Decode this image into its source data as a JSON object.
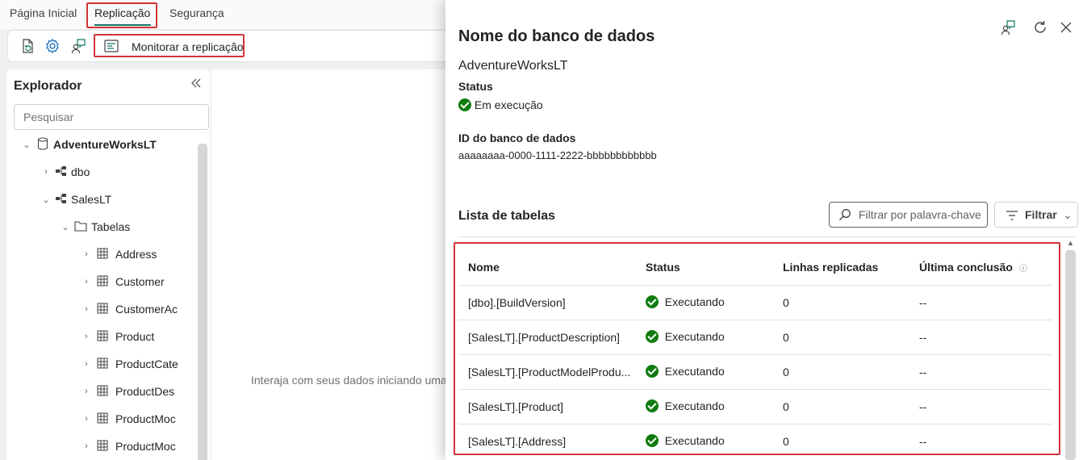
{
  "ribbon": {
    "tabs": [
      "Página Inicial",
      "Replicação",
      "Segurança"
    ],
    "active_tab": "Replicação"
  },
  "toolbar": {
    "monitor_label": "Monitorar a replicação",
    "icons": [
      "document-refresh-icon",
      "gear-icon",
      "person-feedback-icon",
      "monitor-icon"
    ]
  },
  "explorer": {
    "title": "Explorador",
    "search_placeholder": "Pesquisar",
    "tree": [
      {
        "label": "AdventureWorksLT",
        "icon": "database-icon",
        "expanded": true
      },
      {
        "label": "dbo",
        "icon": "schema-icon",
        "expanded": false
      },
      {
        "label": "SalesLT",
        "icon": "schema-icon",
        "expanded": true
      },
      {
        "label": "Tabelas",
        "icon": "folder-icon",
        "expanded": true
      },
      {
        "label": "Address",
        "icon": "table-icon"
      },
      {
        "label": "Customer",
        "icon": "table-icon"
      },
      {
        "label": "CustomerAc",
        "icon": "table-icon"
      },
      {
        "label": "Product",
        "icon": "table-icon"
      },
      {
        "label": "ProductCate",
        "icon": "table-icon"
      },
      {
        "label": "ProductDes",
        "icon": "table-icon"
      },
      {
        "label": "ProductMoc",
        "icon": "table-icon"
      },
      {
        "label": "ProductMoc",
        "icon": "table-icon"
      }
    ]
  },
  "main": {
    "empty_text": "Interaja com seus dados iniciando uma"
  },
  "panel": {
    "title": "Nome do banco de dados",
    "db_name": "AdventureWorksLT",
    "status_label": "Status",
    "status_value": "Em execução",
    "id_label": "ID do banco de dados",
    "id_value": "aaaaaaaa-0000-1111-2222-bbbbbbbbbbbb",
    "list_title": "Lista de tabelas",
    "filter_keyword_placeholder": "Filtrar por palavra-chave",
    "filter_label": "Filtrar",
    "columns": [
      "Nome",
      "Status",
      "Linhas replicadas",
      "Última conclusão"
    ],
    "rows": [
      {
        "name": "[dbo].[BuildVersion]",
        "status": "Executando",
        "rows": "0",
        "last": "--"
      },
      {
        "name": "[SalesLT].[ProductDescription]",
        "status": "Executando",
        "rows": "0",
        "last": "--"
      },
      {
        "name": "[SalesLT].[ProductModelProdu...",
        "status": "Executando",
        "rows": "0",
        "last": "--"
      },
      {
        "name": "[SalesLT].[Product]",
        "status": "Executando",
        "rows": "0",
        "last": "--"
      },
      {
        "name": "[SalesLT].[Address]",
        "status": "Executando",
        "rows": "0",
        "last": "--"
      }
    ],
    "status_color": "#107c10"
  },
  "colors": {
    "highlight": "#d13438",
    "accent": "#117865"
  }
}
